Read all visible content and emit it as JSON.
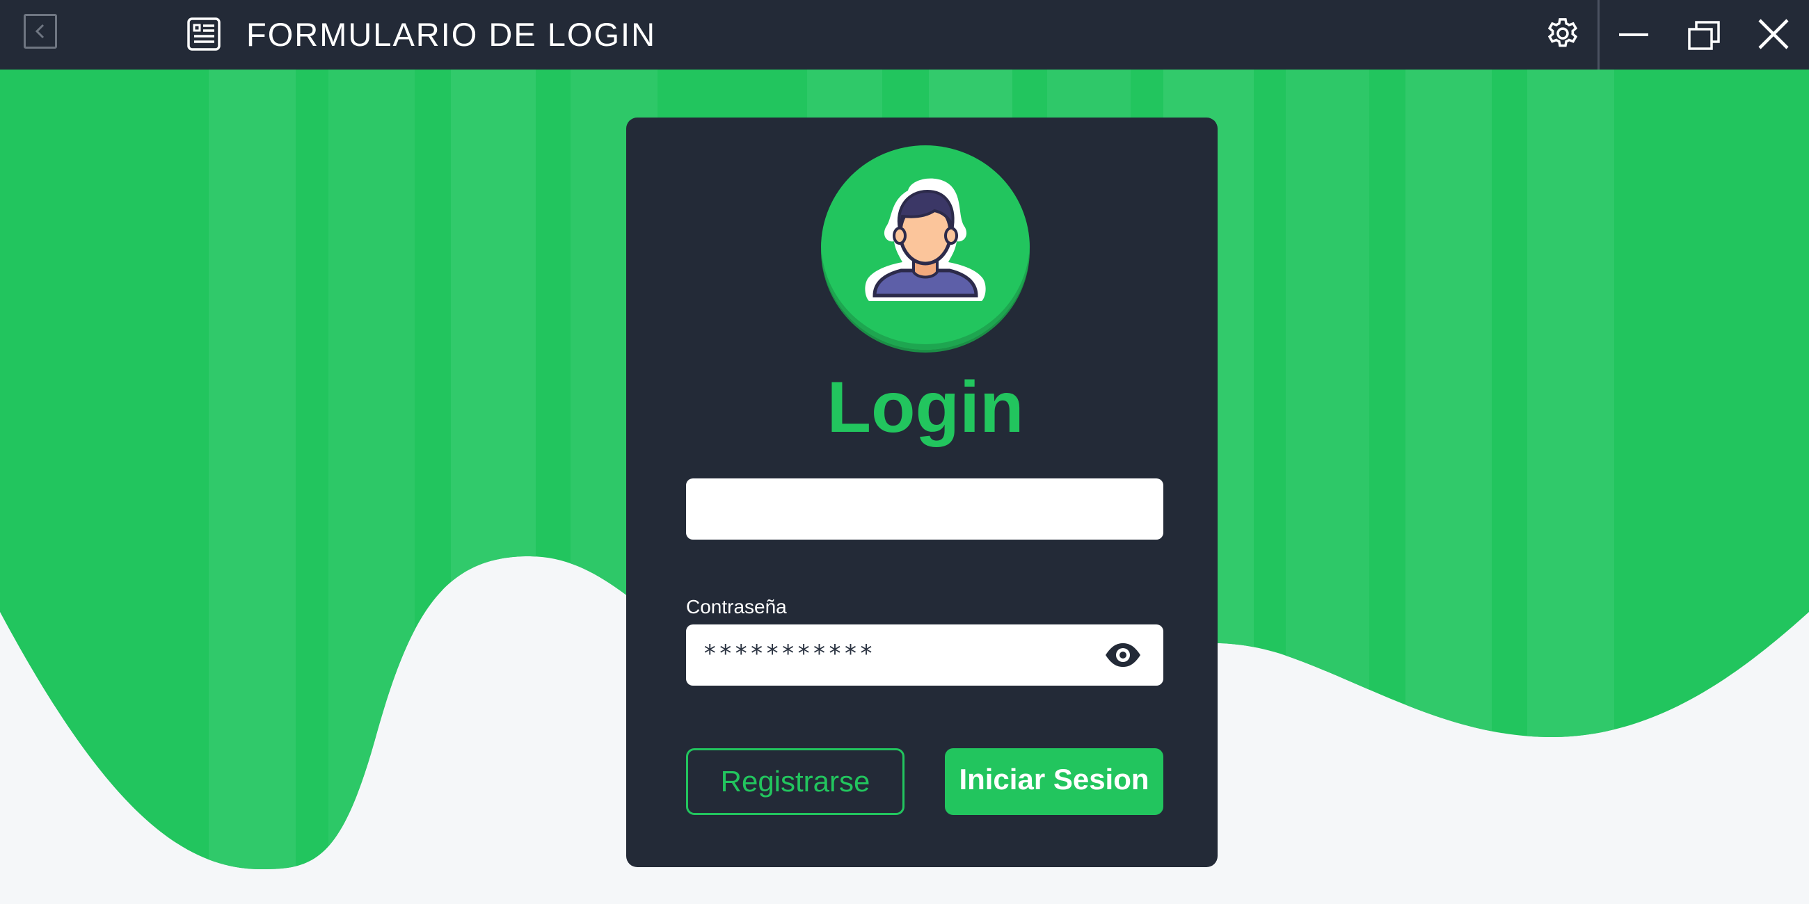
{
  "window": {
    "title": "FORMULARIO DE LOGIN",
    "back_icon": "chevron-left-icon",
    "app_icon": "form-icon",
    "settings_icon": "gear-icon",
    "minimize_icon": "minimize-icon",
    "restore_icon": "restore-icon",
    "close_icon": "close-icon"
  },
  "login": {
    "avatar_icon": "user-avatar-icon",
    "title": "Login",
    "username": {
      "value": "",
      "placeholder": ""
    },
    "password": {
      "label": "Contraseña",
      "value": "***********",
      "toggle_icon": "eye-icon"
    },
    "register_label": "Registrarse",
    "submit_label": "Iniciar Sesion"
  },
  "colors": {
    "accent": "#22c55e",
    "accent_light": "#33c96b",
    "dark": "#232a37",
    "background": "#f5f7f9"
  }
}
